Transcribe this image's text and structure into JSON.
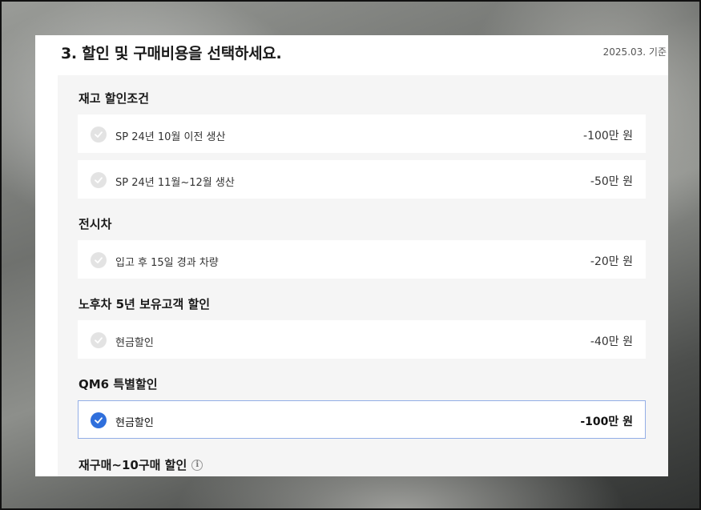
{
  "header": {
    "title": "3. 할인 및 구매비용을 선택하세요.",
    "date_note": "2025.03. 기준"
  },
  "sections": [
    {
      "title": "재고 할인조건",
      "options": [
        {
          "label": "SP 24년 10월 이전 생산",
          "amount": "-100만 원",
          "selected": false
        },
        {
          "label": "SP 24년 11월~12월 생산",
          "amount": "-50만 원",
          "selected": false
        }
      ]
    },
    {
      "title": "전시차",
      "options": [
        {
          "label": "입고 후 15일 경과 차량",
          "amount": "-20만 원",
          "selected": false
        }
      ]
    },
    {
      "title": "노후차 5년 보유고객 할인",
      "options": [
        {
          "label": "현금할인",
          "amount": "-40만 원",
          "selected": false
        }
      ]
    },
    {
      "title": "QM6 특별할인",
      "options": [
        {
          "label": "현금할인",
          "amount": "-100만 원",
          "selected": true
        }
      ]
    },
    {
      "title": "재구매~10구매 할인",
      "info_icon": "i",
      "options": []
    }
  ],
  "icons": {
    "check": "check-circle-icon",
    "info": "info-icon"
  },
  "colors": {
    "accent": "#2f6fdc",
    "selected_border": "#93aee6",
    "unchecked": "#e3e3e3"
  }
}
